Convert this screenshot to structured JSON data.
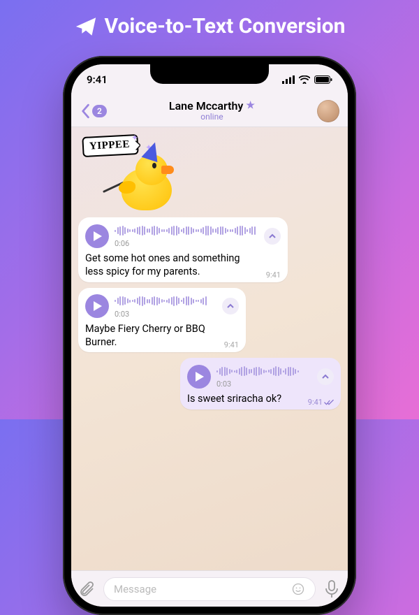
{
  "banner": {
    "title": "Voice-to-Text Conversion"
  },
  "statusbar": {
    "time": "9:41"
  },
  "nav": {
    "back_badge": "2",
    "chat_name": "Lane Mccarthy",
    "status": "online"
  },
  "sticker": {
    "label": "YIPPEE"
  },
  "messages": {
    "m1": {
      "duration": "0:06",
      "text": "Get some hot ones and something less spicy for my parents.",
      "time": "9:41"
    },
    "m2": {
      "duration": "0:03",
      "text": "Maybe Fiery Cherry or BBQ Burner.",
      "time": "9:41"
    },
    "m3": {
      "duration": "0:03",
      "text": "Is sweet sriracha ok?",
      "time": "9:41"
    }
  },
  "input": {
    "placeholder": "Message"
  }
}
